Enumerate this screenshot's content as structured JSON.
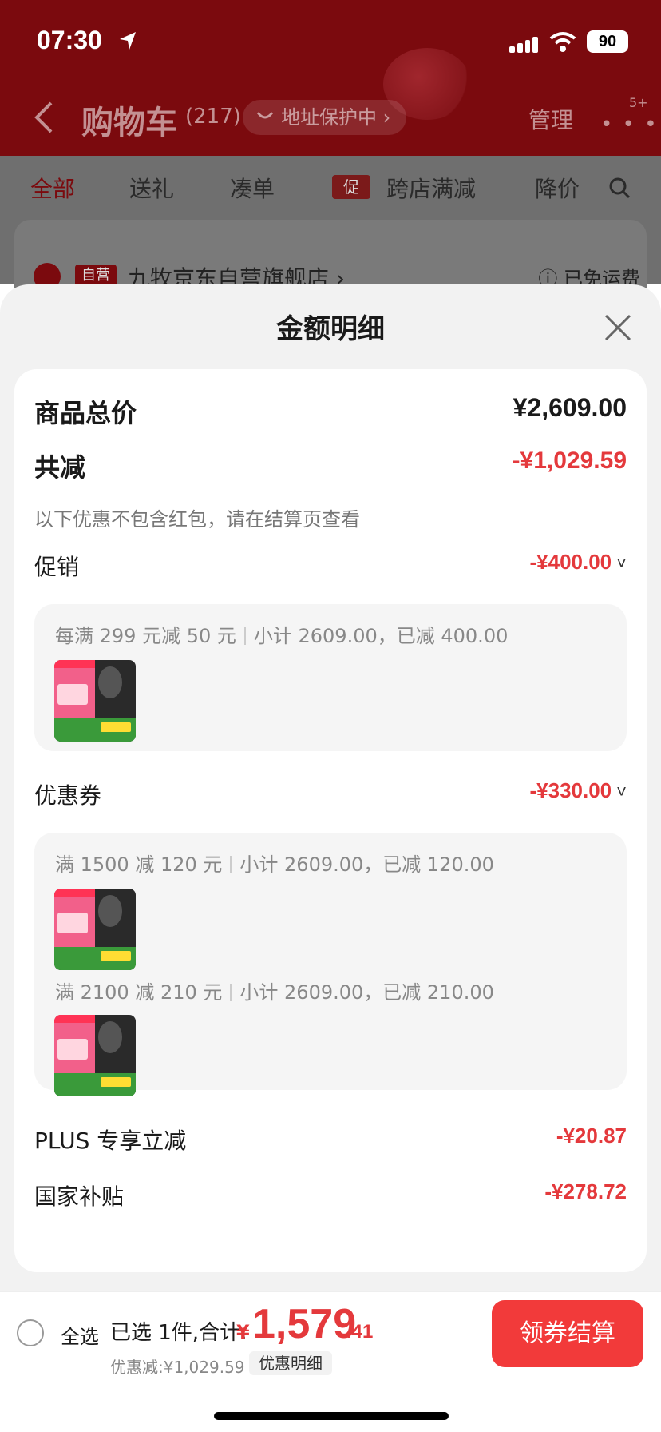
{
  "status_bar": {
    "time": "07:30",
    "battery": "90"
  },
  "navbar": {
    "title": "购物车",
    "count": "(217)",
    "address_protect": "地址保护中 ›",
    "manage": "管理",
    "more": "• • •",
    "badge": "5+"
  },
  "tabs": {
    "all": "全部",
    "gift": "送礼",
    "combine": "凑单",
    "promo_badge": "促",
    "cross_store": "跨店满减",
    "price_drop": "降价"
  },
  "shop": {
    "tag": "自营",
    "name": "九牧京东自营旗舰店 ›",
    "shipping": "ⓘ 已免运费"
  },
  "sheet": {
    "title": "金额明细",
    "goods_total_label": "商品总价",
    "goods_total_value": "¥2,609.00",
    "total_reduce_label": "共减",
    "total_reduce_value": "-¥1,029.59",
    "note": "以下优惠不包含红包，请在结算页查看",
    "promotion": {
      "label": "促销",
      "value": "-¥400.00",
      "rule": "每满 299 元减 50 元",
      "subtotal": "小计 2609.00，已减 400.00"
    },
    "coupon": {
      "label": "优惠券",
      "value": "-¥330.00",
      "items": [
        {
          "rule": "满 1500 减 120 元",
          "subtotal": "小计 2609.00，已减 120.00"
        },
        {
          "rule": "满 2100 减 210 元",
          "subtotal": "小计 2609.00，已减 210.00"
        }
      ]
    },
    "plus": {
      "label": "PLUS 专享立减",
      "value": "-¥20.87"
    },
    "subsidy": {
      "label": "国家补贴",
      "value": "-¥278.72"
    }
  },
  "bottom": {
    "select_all": "全选",
    "selected_summary": "已选 1件,合计:",
    "currency": "¥",
    "total_int": "1,579",
    "total_dec": ".41",
    "discount": "优惠减:¥1,029.59",
    "detail_chip": "优惠明细",
    "checkout": "领券结算"
  },
  "colors": {
    "accent_red": "#e4393c",
    "button_red": "#f23a3a",
    "header_dark_red": "#7b0a0e"
  }
}
